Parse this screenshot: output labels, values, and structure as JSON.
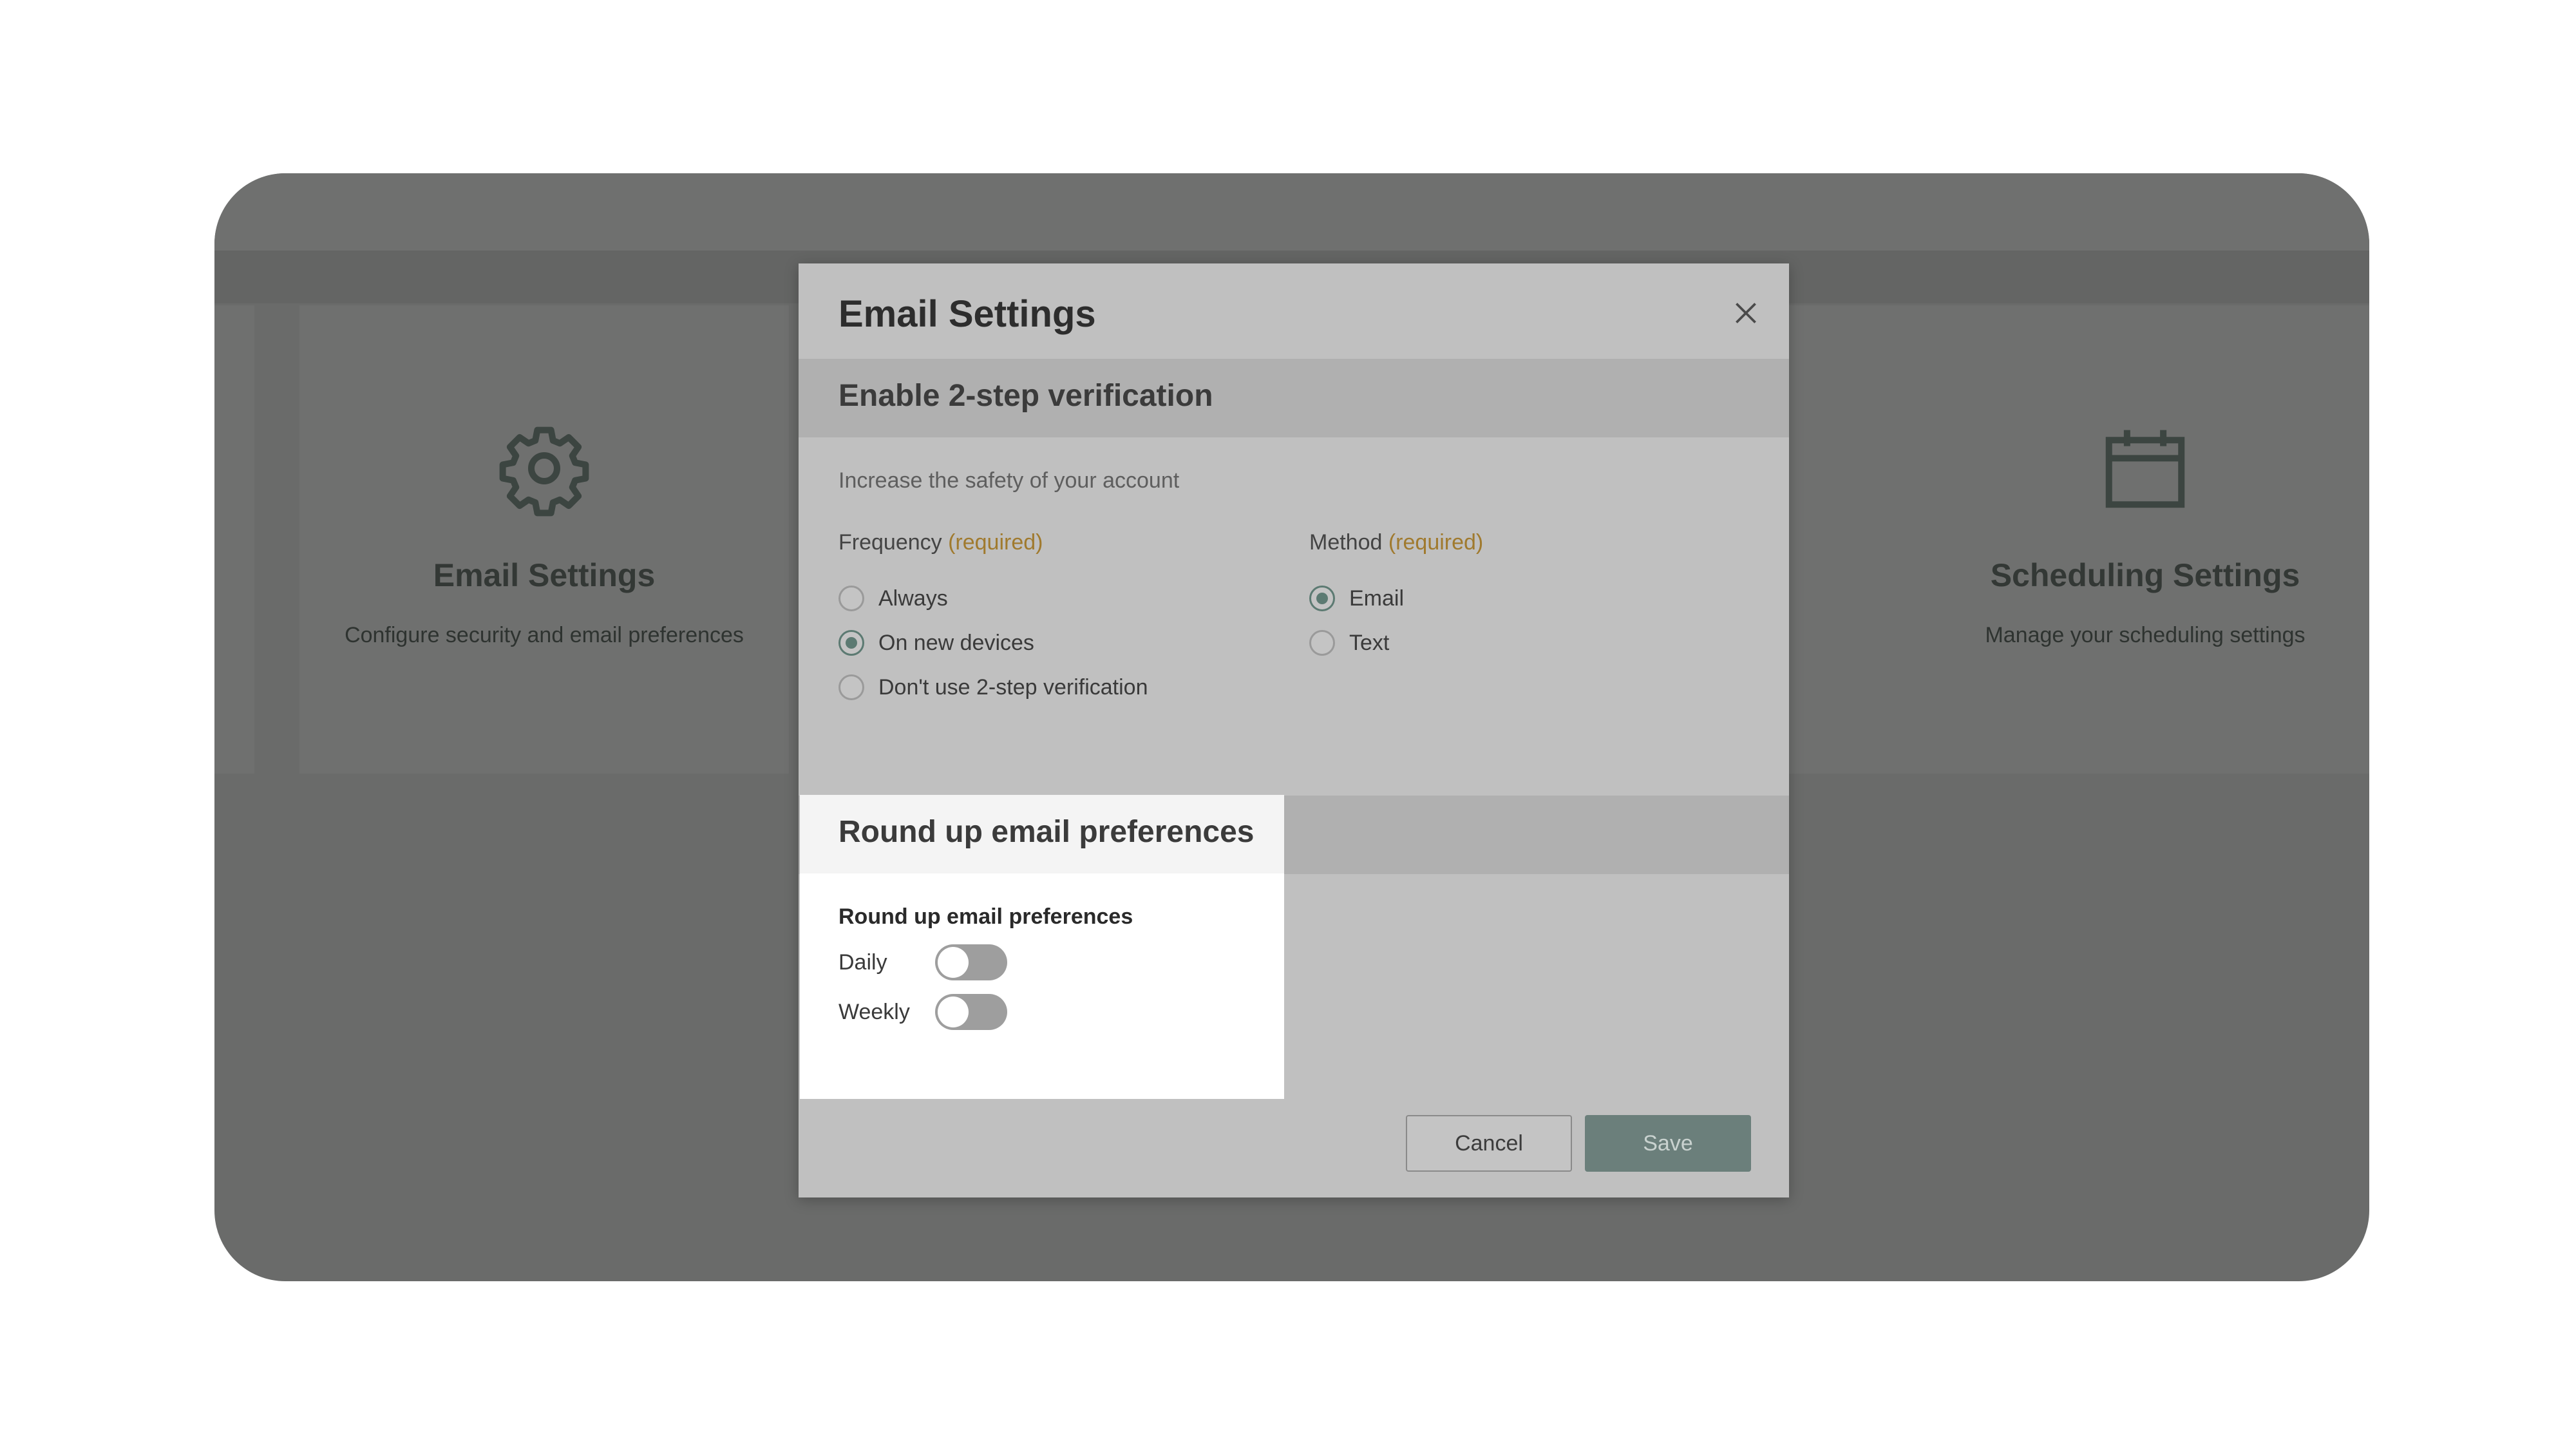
{
  "background_cards": [
    {
      "icon": "gear-icon",
      "title": "Email Settings",
      "description": "Configure security and email preferences"
    },
    {
      "icon": "calendar-icon",
      "title": "Scheduling Settings",
      "description": "Manage your scheduling settings"
    }
  ],
  "modal": {
    "title": "Email Settings",
    "close_icon": "close-icon",
    "two_step": {
      "heading": "Enable 2-step verification",
      "help": "Increase the safety of your account",
      "frequency": {
        "label": "Frequency",
        "required": "(required)",
        "options": [
          "Always",
          "On new devices",
          "Don't use 2-step verification"
        ],
        "selected": "On new devices"
      },
      "method": {
        "label": "Method",
        "required": "(required)",
        "options": [
          "Email",
          "Text"
        ],
        "selected": "Email"
      }
    },
    "roundup": {
      "heading": "Round up email preferences",
      "subheading": "Round up email preferences",
      "toggles": [
        {
          "label": "Daily",
          "on": false
        },
        {
          "label": "Weekly",
          "on": false
        }
      ]
    },
    "buttons": {
      "cancel": "Cancel",
      "save": "Save"
    }
  },
  "colors": {
    "overlay": "#6a6b6a",
    "modal": "#c0c0c0",
    "accent": "#5c7a72",
    "required": "#a07a2e",
    "save_button": "#6b7f7b"
  }
}
